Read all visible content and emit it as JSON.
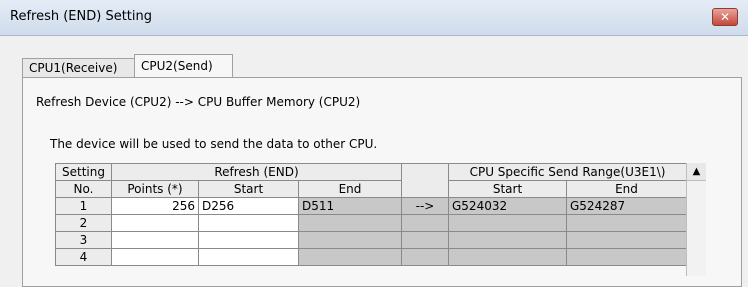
{
  "window": {
    "title": "Refresh (END) Setting",
    "close_glyph": "✕"
  },
  "tabs": [
    {
      "label": "CPU1(Receive)",
      "active": false
    },
    {
      "label": "CPU2(Send)",
      "active": true
    }
  ],
  "panel": {
    "heading": "Refresh Device (CPU2) --> CPU Buffer Memory (CPU2)",
    "note": "The device will be used to send the data to other CPU."
  },
  "table": {
    "h_setting": "Setting",
    "h_no": "No.",
    "h_refresh": "Refresh (END)",
    "h_cpu_range": "CPU Specific Send Range(U3E1\\)",
    "h_points": "Points (*)",
    "h_start": "Start",
    "h_end": "End",
    "h_start2": "Start",
    "h_end2": "End",
    "rows": [
      {
        "no": "1",
        "points": "256",
        "start": "D256",
        "end": "D511",
        "arrow": "-->",
        "cpu_start": "G524032",
        "cpu_end": "G524287"
      },
      {
        "no": "2",
        "points": "",
        "start": "",
        "end": "",
        "arrow": "",
        "cpu_start": "",
        "cpu_end": ""
      },
      {
        "no": "3",
        "points": "",
        "start": "",
        "end": "",
        "arrow": "",
        "cpu_start": "",
        "cpu_end": ""
      },
      {
        "no": "4",
        "points": "",
        "start": "",
        "end": "",
        "arrow": "",
        "cpu_start": "",
        "cpu_end": ""
      }
    ]
  },
  "scrollbar": {
    "up_glyph": "▲"
  }
}
